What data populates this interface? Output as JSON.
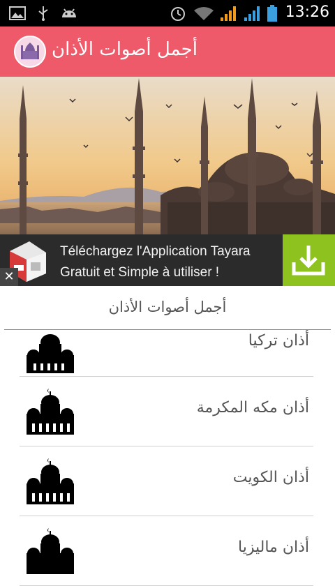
{
  "status_bar": {
    "time": "13:26"
  },
  "app_bar": {
    "title": "أجمل أصوات الأذان"
  },
  "ad": {
    "line1": "Téléchargez l'Application Tayara",
    "line2": "Gratuit et Simple à utiliser !",
    "close_label": "✕"
  },
  "list": {
    "header": "أجمل أصوات الأذان",
    "items": [
      {
        "label": "أذان تركيا"
      },
      {
        "label": "أذان مكه المكرمة"
      },
      {
        "label": "أذان الكويت"
      },
      {
        "label": "أذان ماليزيا"
      }
    ]
  },
  "colors": {
    "app_bar": "#ef5a6a",
    "ad_background": "#2b2b2b",
    "ad_download": "#8dc21f",
    "status_bar": "#000000"
  },
  "icons": {
    "status_left": [
      "image-icon",
      "usb-icon",
      "android-icon"
    ],
    "status_right": [
      "alarm-icon",
      "wifi-icon",
      "signal-icon",
      "signal-icon",
      "battery-icon"
    ],
    "list_item": "mosque-icon",
    "ad_action": "download-icon"
  }
}
